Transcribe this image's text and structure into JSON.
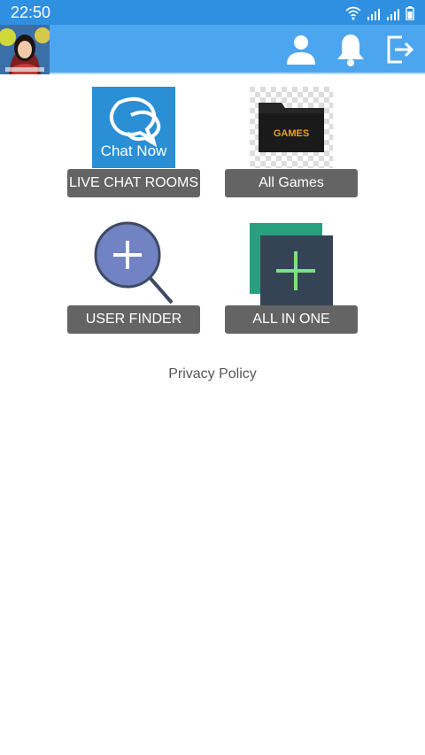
{
  "status_bar": {
    "time": "22:50"
  },
  "app_bar": {
    "avatar_icon": "profile-photo",
    "profile_icon": "person-icon",
    "notifications_icon": "bell-icon",
    "logout_icon": "exit-icon"
  },
  "tiles": [
    {
      "label": "LIVE CHAT ROOMS",
      "image_text": "Chat Now",
      "icon": "chat-bubbles-icon"
    },
    {
      "label": "All Games",
      "image_text": "GAMES",
      "icon": "games-folder-icon"
    },
    {
      "label": "USER FINDER",
      "icon": "search-plus-icon"
    },
    {
      "label": "ALL IN ONE",
      "icon": "add-square-icon"
    }
  ],
  "footer": {
    "privacy_policy": "Privacy Policy"
  },
  "colors": {
    "status_bar": "#2f8fe0",
    "app_bar": "#4ba6ef",
    "button": "#646464"
  }
}
